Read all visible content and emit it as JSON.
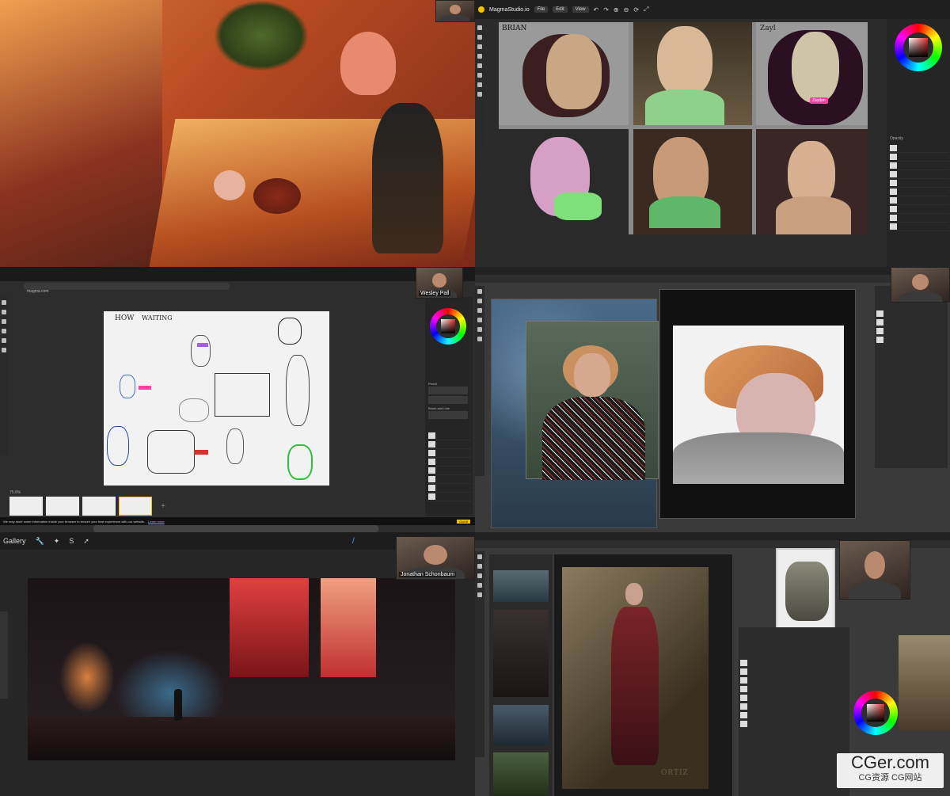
{
  "colors": {
    "dark_ui": "#2b2b2b",
    "accent_yellow": "#f2c200",
    "label_purple": "#a35cff",
    "label_pink": "#ff3fa4",
    "label_red": "#d93030",
    "label_green": "#2fbf3a"
  },
  "panel_magma_top": {
    "app_title": "MagmaStudio.io",
    "menu": [
      "File",
      "Edit",
      "View"
    ],
    "sketch_labels": [
      "BRIAN",
      "Zayl"
    ],
    "cursor_tag": "Zayden",
    "layers_header": "Opacity"
  },
  "panel_magma_mid": {
    "url": "magma.com",
    "sketch_titles": [
      "HOW",
      "WAITING"
    ],
    "name_tags": [
      "",
      ""
    ],
    "cam_name": "Wesley Pall",
    "brush_sections": [
      "Pencil",
      "Brush and Line"
    ],
    "cookie_text": "We may store some information inside your browser to ensure your best experience with our website.",
    "cookie_link": "Learn more",
    "cookie_button": "Got it!",
    "zoom": "75.8%",
    "add_tab_icon": "plus-icon"
  },
  "panel_photoshop_mid": {
    "cam_name": ""
  },
  "panel_procreate": {
    "gallery_label": "Gallery",
    "cam_name": "Jonathan Schonbaum"
  },
  "panel_photoshop_bottom": {
    "signature": "ORTIZ"
  },
  "watermark": {
    "main": "CGer.com",
    "sub": "CG资源 CG网站"
  }
}
